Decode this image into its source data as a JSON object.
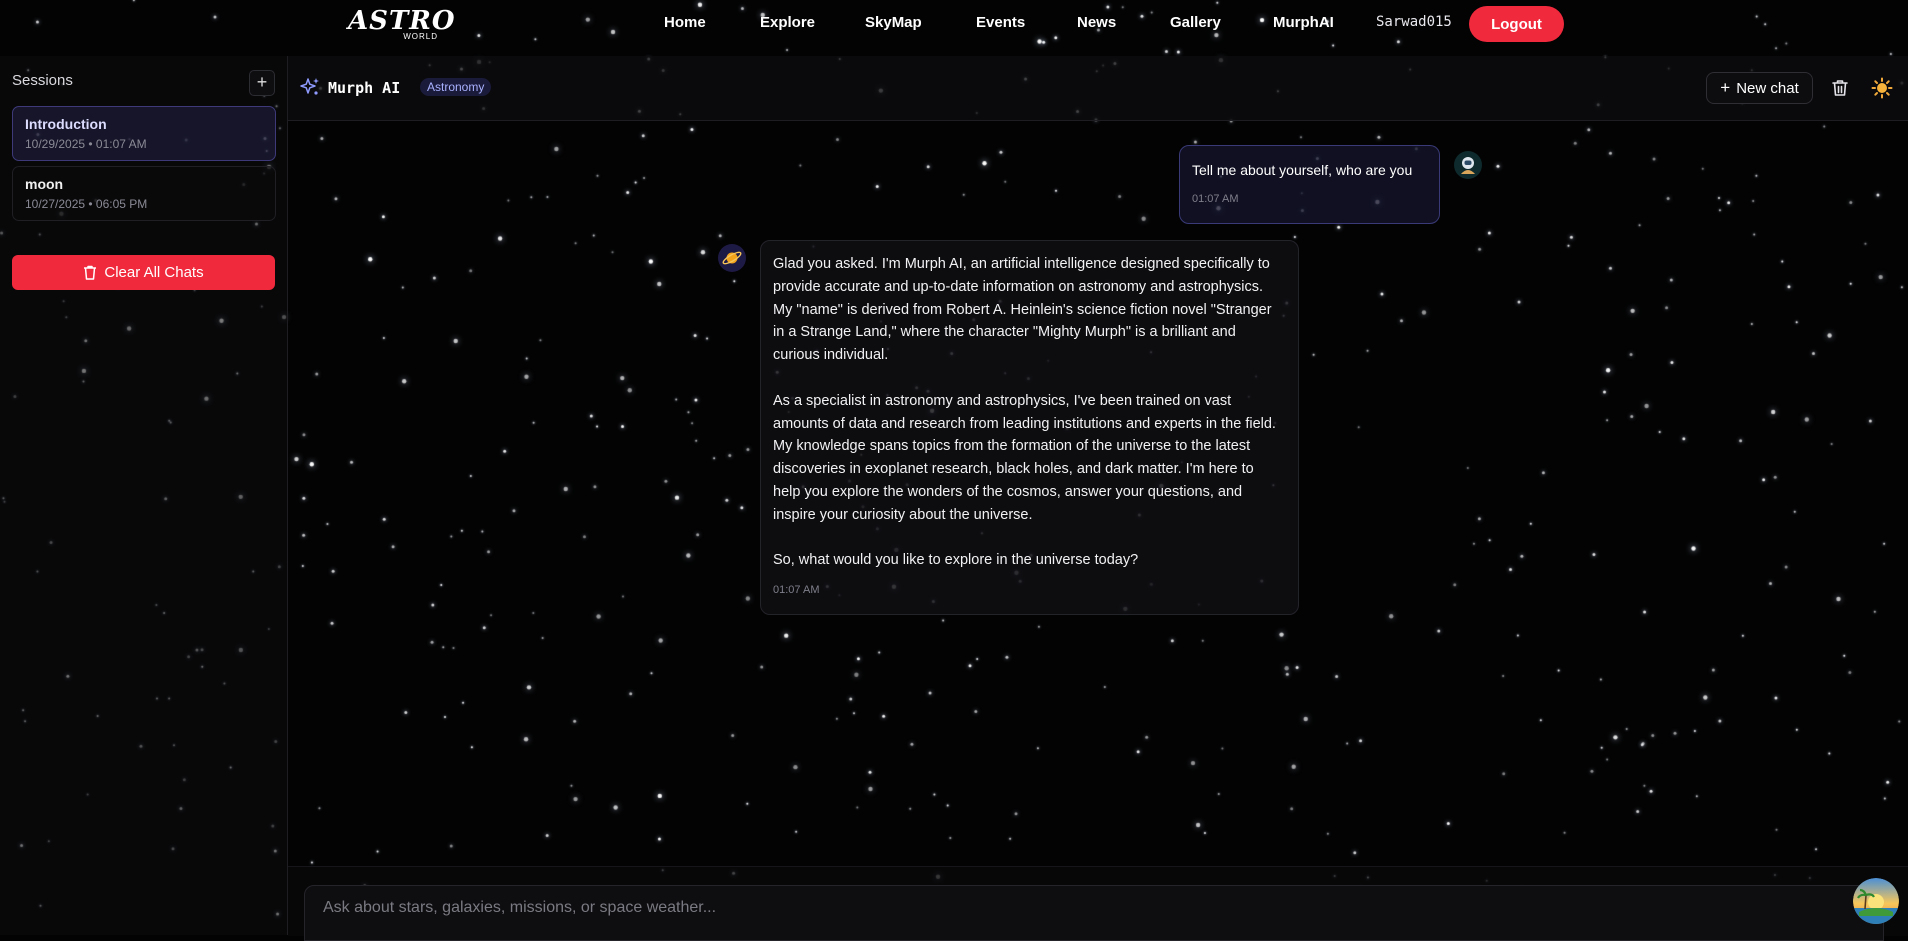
{
  "nav": {
    "logo_text": "ASTRO",
    "logo_sub": "WORLD",
    "links": [
      "Home",
      "Explore",
      "SkyMap",
      "Events",
      "News",
      "Gallery",
      "MurphAI"
    ],
    "username": "Sarwad015",
    "logout_label": "Logout",
    "accent_color": "#f0293d"
  },
  "sidebar": {
    "title": "Sessions",
    "add_icon": "plus-icon",
    "sessions": [
      {
        "name": "Introduction",
        "time": "10/29/2025 • 01:07 AM",
        "active": true
      },
      {
        "name": "moon",
        "time": "10/27/2025 • 06:05 PM",
        "active": false
      }
    ],
    "clear_label": "Clear All Chats",
    "clear_icon": "trash-icon"
  },
  "chat_header": {
    "bot_name": "Murph AI",
    "tag": "Astronomy",
    "new_chat_label": "New chat",
    "icons": [
      "sparkles-icon",
      "plus-icon",
      "trash-icon",
      "sun-icon"
    ]
  },
  "messages": {
    "user": {
      "text": "Tell me about yourself, who are you",
      "time": "01:07 AM",
      "avatar": "astronaut-avatar"
    },
    "bot": {
      "paragraphs": [
        "Glad you asked. I'm Murph AI, an artificial intelligence designed specifically to provide accurate and up-to-date information on astronomy and astrophysics. My \"name\" is derived from Robert A. Heinlein's science fiction novel \"Stranger in a Strange Land,\" where the character \"Mighty Murph\" is a brilliant and curious individual.",
        "As a specialist in astronomy and astrophysics, I've been trained on vast amounts of data and research from leading institutions and experts in the field. My knowledge spans topics from the formation of the universe to the latest discoveries in exoplanet research, black holes, and dark matter. I'm here to help you explore the wonders of the cosmos, answer your questions, and inspire your curiosity about the universe.",
        "So, what would you like to explore in the universe today?"
      ],
      "time": "01:07 AM",
      "avatar": "planet-avatar"
    }
  },
  "input": {
    "placeholder": "Ask about stars, galaxies, missions, or space weather..."
  },
  "fab_icon": "sunset-island-icon"
}
